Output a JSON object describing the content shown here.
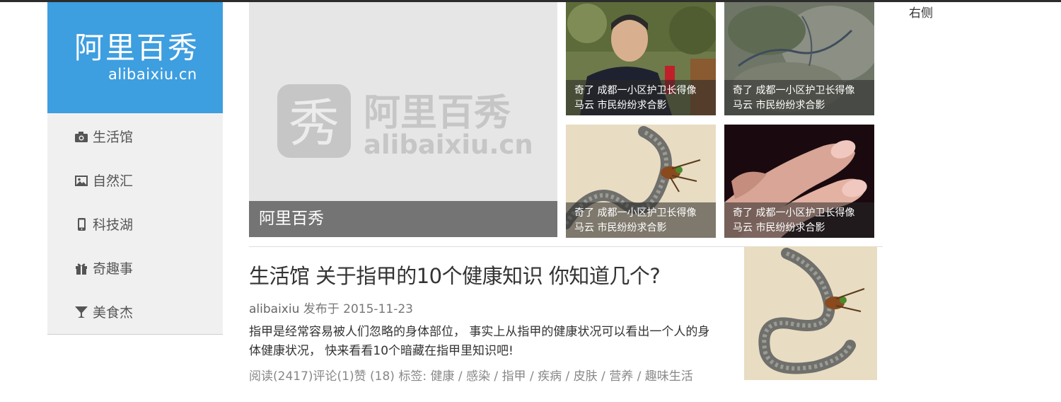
{
  "brand": {
    "name_cn": "阿里百秀",
    "name_en": "alibaixiu.cn",
    "color": "#3d9ee0"
  },
  "nav": [
    {
      "label": "生活馆",
      "icon": "camera-icon"
    },
    {
      "label": "自然汇",
      "icon": "picture-icon"
    },
    {
      "label": "科技湖",
      "icon": "mobile-phone-icon"
    },
    {
      "label": "奇趣事",
      "icon": "gift-icon"
    },
    {
      "label": "美食杰",
      "icon": "cocktail-glass-icon"
    }
  ],
  "hero": {
    "caption": "阿里百秀",
    "watermark_cn": "阿里百秀",
    "watermark_en": "alibaixiu.cn",
    "watermark_glyph": "秀"
  },
  "thumbnails": [
    {
      "line1": "奇了 成都一小区护卫长得像",
      "line2": "马云 市民纷纷求合影"
    },
    {
      "line1": "奇了 成都一小区护卫长得像",
      "line2": "马云 市民纷纷求合影"
    },
    {
      "line1": "奇了 成都一小区护卫长得像",
      "line2": "马云 市民纷纷求合影"
    },
    {
      "line1": "奇了 成都一小区护卫长得像",
      "line2": "马云 市民纷纷求合影"
    }
  ],
  "right_label": "右侧",
  "article": {
    "title": "生活馆 关于指甲的10个健康知识 你知道几个?",
    "author": "alibaixiu",
    "published_label": "发布于",
    "date": "2015-11-23",
    "summary": "指甲是经常容易被人们忽略的身体部位， 事实上从指甲的健康状况可以看出一个人的身体健康状况， 快来看看10个暗藏在指甲里知识吧!",
    "stats": "阅读(2417)评论(1)赞 (18)",
    "tags_label": "标签:",
    "tags": [
      "健康",
      "感染",
      "指甲",
      "疾病",
      "皮肤",
      "营养",
      "趣味生活"
    ]
  }
}
